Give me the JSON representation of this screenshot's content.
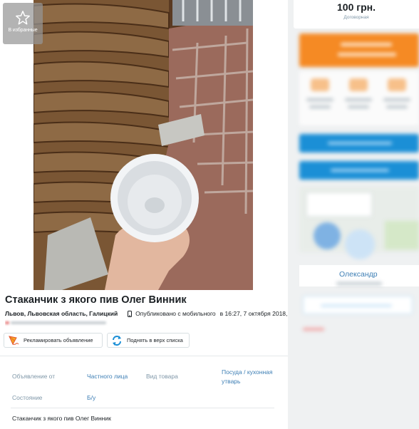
{
  "favorite": {
    "label": "В избранные",
    "icon": "star-outline-icon"
  },
  "ad": {
    "title": "Стаканчик з якого пив Олег Винник",
    "location": "Львов, Львовская область, Галицкий",
    "posted_via": "Опубликовано с мобильного",
    "posted_at": "в 16:27, 7 октября 2018,",
    "description": "Стаканчик з якого пив Олег Винник"
  },
  "actions": {
    "promote_label": "Рекламировать объявление",
    "promote_icon": "kite-icon",
    "raise_label": "Поднять в верх списка",
    "raise_icon": "refresh-arrows-icon"
  },
  "details": [
    {
      "label": "Объявление от",
      "value": "Частного лица"
    },
    {
      "label": "Вид товара",
      "value": "Посуда / кухонная утварь"
    },
    {
      "label": "Состояние",
      "value": "Б/у"
    }
  ],
  "price": {
    "amount": "100 грн.",
    "note": "Договорная"
  },
  "seller": {
    "name": "Олександр"
  },
  "colors": {
    "accent_orange": "#f58a24",
    "accent_blue": "#1b8fd6",
    "link_blue": "#3e7fb5",
    "label_gray": "#7f97a8",
    "text_dark": "#1b2024"
  }
}
